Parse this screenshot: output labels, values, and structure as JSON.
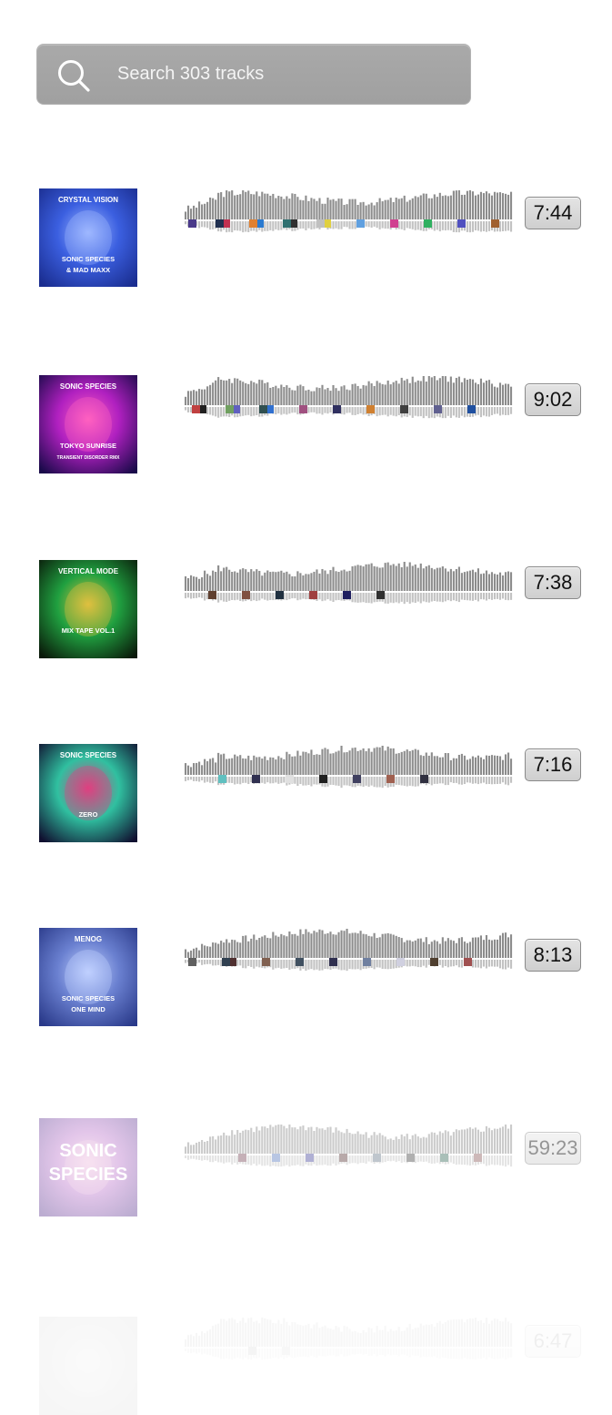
{
  "search": {
    "placeholder": "Search 303 tracks",
    "icon": "magnifier-icon"
  },
  "colors": {
    "search_bg": "#a4a4a4",
    "waveform": "#8c8c8c",
    "duration_bg": "#d8d8d8"
  },
  "tracks": [
    {
      "duration": "7:44",
      "cover": {
        "lines": [
          "CRYSTAL VISION",
          "SONIC SPECIES",
          "& MAD MAXX"
        ],
        "palette": [
          "#1a2d8f",
          "#3b5fe0",
          "#9fb8ff"
        ]
      },
      "thumb_colors": [
        "#4a3a8a",
        "#c03050",
        "#2a7ad0",
        "#303030",
        "#e0d040",
        "#60a0e0",
        "#d04090",
        "#30b060",
        "#5050c0",
        "#a06030",
        "#203050",
        "#e08030",
        "#307070",
        "#c0c0c0"
      ]
    },
    {
      "duration": "9:02",
      "cover": {
        "lines": [
          "SONIC SPECIES",
          "TOKYO SUNRISE",
          "TRANSIENT DISORDER RMX"
        ],
        "palette": [
          "#1a0a4a",
          "#b020c0",
          "#ff60c0"
        ]
      },
      "thumb_colors": [
        "#202020",
        "#6060c0",
        "#3070d0",
        "#a05080",
        "#303060",
        "#d08030",
        "#404040",
        "#606090",
        "#2050a0",
        "#c04040",
        "#70a060",
        "#305050"
      ]
    },
    {
      "duration": "7:38",
      "cover": {
        "lines": [
          "VERTICAL MODE",
          "MIX TAPE VOL.1"
        ],
        "palette": [
          "#0a1a0a",
          "#20a040",
          "#e0c040"
        ]
      },
      "thumb_colors": [
        "#604030",
        "#805040",
        "#203040",
        "#a04040",
        "#202060",
        "#303030"
      ]
    },
    {
      "duration": "7:16",
      "cover": {
        "lines": [
          "SONIC SPECIES",
          "ZERO"
        ],
        "palette": [
          "#101030",
          "#30c0a0",
          "#e04080"
        ]
      },
      "thumb_colors": [
        "#60c0c0",
        "#303050",
        "#e0e0e0",
        "#202020",
        "#404060",
        "#a06050",
        "#303040"
      ]
    },
    {
      "duration": "8:13",
      "cover": {
        "lines": [
          "MENOG",
          "SONIC SPECIES",
          "ONE MIND"
        ],
        "palette": [
          "#2a3a8a",
          "#6a80d0",
          "#c0d0ff"
        ]
      },
      "thumb_colors": [
        "#503030",
        "#806050",
        "#405060",
        "#303050",
        "#7080a0",
        "#d0d0e0",
        "#504030",
        "#a05050",
        "#606060",
        "#304050"
      ]
    },
    {
      "duration": "59:23",
      "cover": {
        "lines": [
          "SONIC",
          "SPECIES"
        ],
        "palette": [
          "#6a4a9a",
          "#c080d0",
          "#f0c0e0"
        ]
      },
      "thumb_colors": [
        "#805060",
        "#6080c0",
        "#5050a0",
        "#604040",
        "#708090",
        "#505050",
        "#407060",
        "#906060"
      ]
    },
    {
      "duration": "6:47",
      "cover": {
        "lines": [],
        "palette": [
          "#808080",
          "#a0a0a0",
          "#c0c0c0"
        ]
      },
      "thumb_colors": [
        "#707070",
        "#808080"
      ]
    }
  ]
}
